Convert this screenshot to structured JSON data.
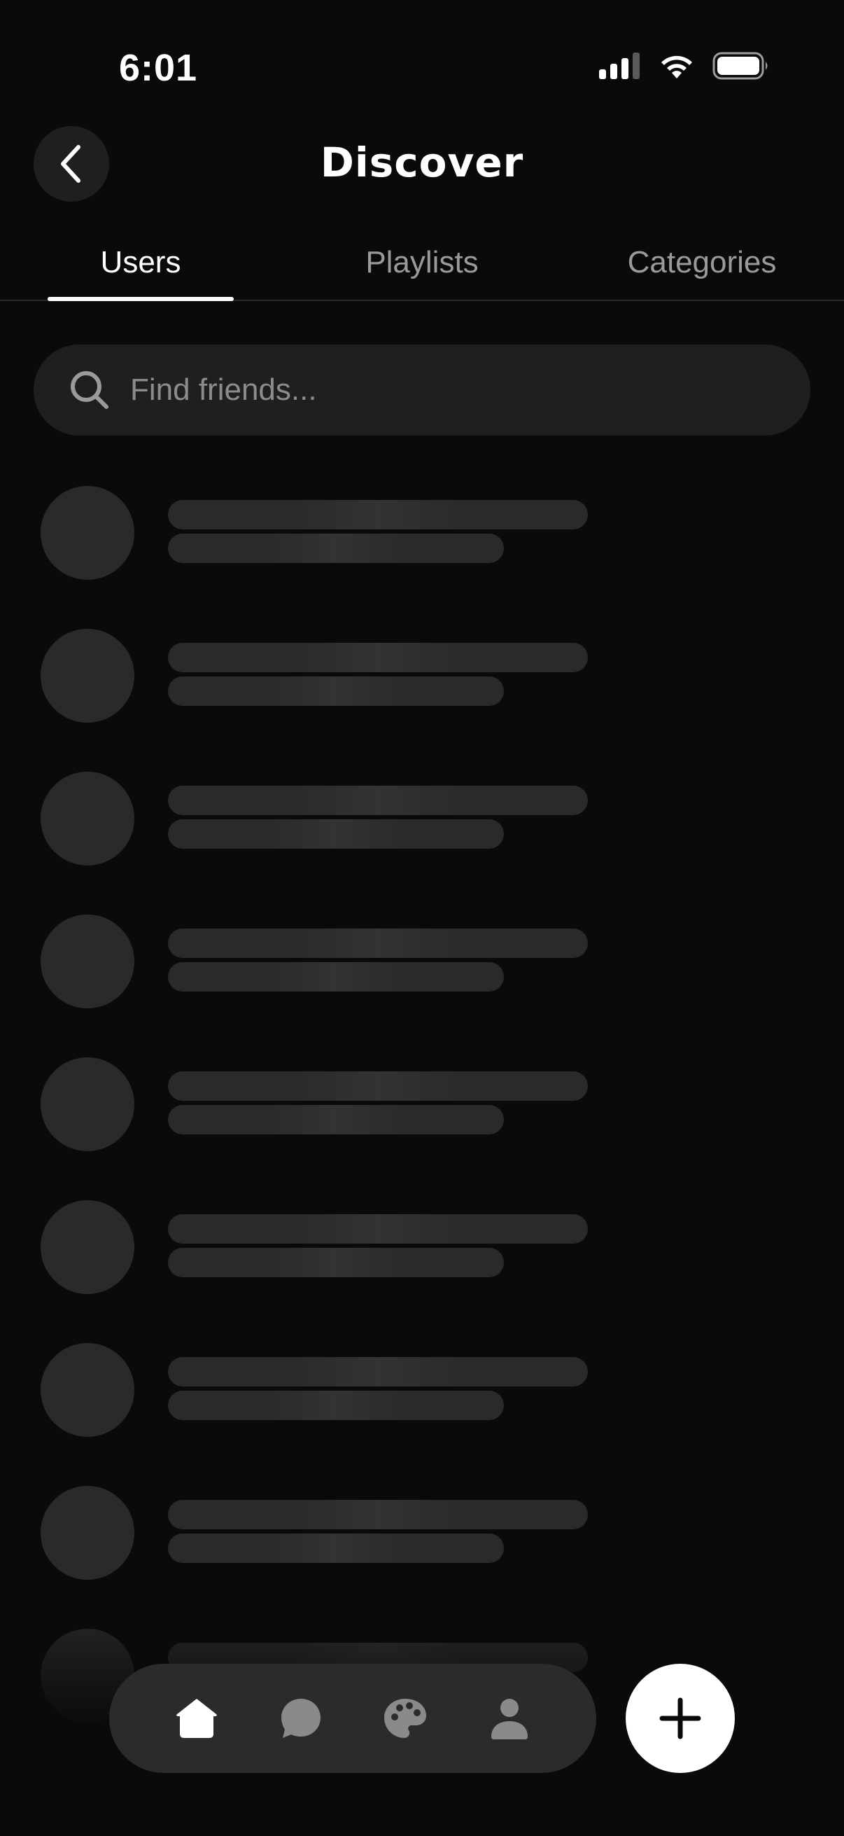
{
  "status_bar": {
    "time": "6:01",
    "icons": [
      "cellular-signal-icon",
      "wifi-icon",
      "battery-icon"
    ]
  },
  "header": {
    "title": "Discover",
    "back_icon": "chevron-left-icon"
  },
  "tabs": [
    {
      "label": "Users",
      "active": true
    },
    {
      "label": "Playlists",
      "active": false
    },
    {
      "label": "Categories",
      "active": false
    }
  ],
  "search": {
    "placeholder": "Find friends...",
    "value": "",
    "icon": "search-icon"
  },
  "list": {
    "state": "loading",
    "skeleton_rows": 9
  },
  "bottom_nav": {
    "items": [
      {
        "icon": "home-icon",
        "active": true
      },
      {
        "icon": "chat-bubble-icon",
        "active": false
      },
      {
        "icon": "palette-icon",
        "active": false
      },
      {
        "icon": "profile-icon",
        "active": false
      }
    ],
    "fab_icon": "plus-icon"
  },
  "colors": {
    "background": "#0a0a0a",
    "surface": "#1f1f1f",
    "skeleton": "#2a2a2a",
    "text_primary": "#ffffff",
    "text_secondary": "#9a9a9a",
    "nav_inactive": "#8a8a8a"
  }
}
